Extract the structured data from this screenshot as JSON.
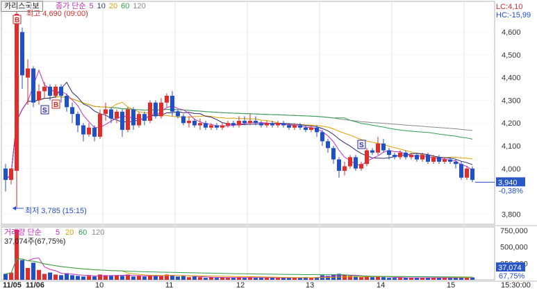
{
  "header": {
    "stock_name": "카리스국보",
    "price_legend": {
      "label": "종가 단순",
      "periods": [
        "5",
        "10",
        "20",
        "60",
        "120"
      ]
    },
    "lc": "LC:4,10",
    "hc": "HC:-15,99",
    "max_note": "최고 4,690 (09:00)",
    "min_note": "최저 3,785 (15:15)",
    "marker_b": "B",
    "marker_s": "S"
  },
  "volume_panel": {
    "legend_label": "거래량 단순",
    "periods": [
      "5",
      "20",
      "60",
      "120"
    ],
    "current": "37,074주(67,75%)",
    "axis_labels": [
      "750,000",
      "500,000",
      "250,000"
    ],
    "current_box": "37,074",
    "current_pct": "67,75%"
  },
  "last_price": {
    "value": "3,940",
    "pct": "-0,38%"
  },
  "colors": {
    "up": "#e62a2a",
    "down": "#1f4fd1",
    "ma5": "#c030c0",
    "ma10": "#2a2a66",
    "ma20": "#e0a000",
    "ma60": "#2ea050",
    "ma120": "#8a8a8a",
    "last_box": "#2a57c8"
  },
  "chart_data": {
    "type": "candlestick",
    "interval": "intraday",
    "price_axis": {
      "ticks": [
        "4,600",
        "4,500",
        "4,400",
        "4,300",
        "4,200",
        "4,100",
        "4,000",
        "3,800"
      ],
      "range": [
        3755,
        4735
      ]
    },
    "x_tick_labels": [
      "11/05",
      "11/06",
      "10",
      "11",
      "12",
      "13",
      "14",
      "15",
      "15:30:00"
    ],
    "annotations": {
      "high": 4690,
      "high_time": "09:00",
      "low": 3785,
      "low_time": "15:15"
    },
    "last_price": 3940,
    "candles": [
      [
        4000,
        3950,
        3900,
        4020
      ],
      [
        3950,
        4000,
        3930,
        4000
      ],
      [
        3990,
        4680,
        3980,
        4690
      ],
      [
        4600,
        4410,
        4350,
        4620
      ],
      [
        4400,
        4440,
        4280,
        4480
      ],
      [
        4440,
        4290,
        4270,
        4450
      ],
      [
        4300,
        4340,
        4280,
        4370
      ],
      [
        4340,
        4360,
        4310,
        4380
      ],
      [
        4360,
        4320,
        4300,
        4370
      ],
      [
        4320,
        4360,
        4310,
        4370
      ],
      [
        4360,
        4320,
        4290,
        4370
      ],
      [
        4320,
        4270,
        4250,
        4330
      ],
      [
        4270,
        4240,
        4200,
        4290
      ],
      [
        4240,
        4190,
        4160,
        4250
      ],
      [
        4190,
        4150,
        4120,
        4200
      ],
      [
        4150,
        4180,
        4140,
        4200
      ],
      [
        4180,
        4140,
        4120,
        4190
      ],
      [
        4140,
        4240,
        4130,
        4260
      ],
      [
        4240,
        4260,
        4210,
        4290
      ],
      [
        4260,
        4220,
        4200,
        4270
      ],
      [
        4220,
        4250,
        4200,
        4260
      ],
      [
        4250,
        4170,
        4140,
        4260
      ],
      [
        4170,
        4260,
        4160,
        4270
      ],
      [
        4260,
        4190,
        4170,
        4270
      ],
      [
        4190,
        4240,
        4180,
        4250
      ],
      [
        4240,
        4210,
        4190,
        4250
      ],
      [
        4210,
        4290,
        4200,
        4300
      ],
      [
        4290,
        4230,
        4220,
        4300
      ],
      [
        4230,
        4290,
        4220,
        4310
      ],
      [
        4290,
        4320,
        4270,
        4330
      ],
      [
        4320,
        4250,
        4230,
        4340
      ],
      [
        4250,
        4230,
        4220,
        4260
      ],
      [
        4230,
        4200,
        4190,
        4240
      ],
      [
        4200,
        4210,
        4180,
        4230
      ],
      [
        4210,
        4190,
        4180,
        4220
      ],
      [
        4190,
        4200,
        4170,
        4220
      ],
      [
        4200,
        4180,
        4170,
        4210
      ],
      [
        4180,
        4190,
        4170,
        4200
      ],
      [
        4190,
        4180,
        4170,
        4200
      ],
      [
        4180,
        4190,
        4170,
        4200
      ],
      [
        4190,
        4200,
        4180,
        4210
      ],
      [
        4200,
        4190,
        4180,
        4210
      ],
      [
        4190,
        4210,
        4180,
        4230
      ],
      [
        4210,
        4200,
        4190,
        4230
      ],
      [
        4200,
        4210,
        4190,
        4240
      ],
      [
        4210,
        4200,
        4190,
        4230
      ],
      [
        4200,
        4190,
        4180,
        4210
      ],
      [
        4190,
        4200,
        4180,
        4210
      ],
      [
        4200,
        4190,
        4180,
        4210
      ],
      [
        4190,
        4200,
        4180,
        4210
      ],
      [
        4200,
        4190,
        4180,
        4210
      ],
      [
        4190,
        4180,
        4170,
        4200
      ],
      [
        4180,
        4190,
        4170,
        4200
      ],
      [
        4190,
        4180,
        4170,
        4200
      ],
      [
        4180,
        4170,
        4160,
        4190
      ],
      [
        4170,
        4180,
        4160,
        4190
      ],
      [
        4180,
        4160,
        4140,
        4190
      ],
      [
        4160,
        4120,
        4100,
        4170
      ],
      [
        4120,
        4090,
        4070,
        4130
      ],
      [
        4090,
        4040,
        4020,
        4100
      ],
      [
        4040,
        3990,
        3960,
        4050
      ],
      [
        3990,
        4010,
        3970,
        4030
      ],
      [
        4010,
        4050,
        4000,
        4060
      ],
      [
        4050,
        4000,
        3990,
        4060
      ],
      [
        4000,
        4020,
        3990,
        4030
      ],
      [
        4020,
        4080,
        4010,
        4090
      ],
      [
        4080,
        4070,
        4060,
        4090
      ],
      [
        4070,
        4110,
        4060,
        4140
      ],
      [
        4110,
        4080,
        4070,
        4130
      ],
      [
        4080,
        4060,
        4040,
        4090
      ],
      [
        4060,
        4050,
        4040,
        4070
      ],
      [
        4050,
        4070,
        4040,
        4080
      ],
      [
        4070,
        4050,
        4040,
        4080
      ],
      [
        4050,
        4060,
        4040,
        4070
      ],
      [
        4060,
        4040,
        4030,
        4070
      ],
      [
        4040,
        4060,
        4030,
        4070
      ],
      [
        4060,
        4030,
        4020,
        4070
      ],
      [
        4030,
        4050,
        4020,
        4060
      ],
      [
        4050,
        4030,
        4020,
        4060
      ],
      [
        4030,
        4040,
        4020,
        4050
      ],
      [
        4040,
        4030,
        4020,
        4050
      ],
      [
        4030,
        4020,
        4000,
        4040
      ],
      [
        4020,
        3960,
        3950,
        4030
      ],
      [
        3960,
        4000,
        3950,
        4010
      ],
      [
        4000,
        3950,
        3940,
        4010
      ]
    ],
    "volume": [
      90,
      110,
      760,
      300,
      180,
      260,
      150,
      90,
      110,
      80,
      70,
      100,
      70,
      60,
      50,
      60,
      50,
      80,
      70,
      60,
      70,
      60,
      80,
      50,
      60,
      50,
      70,
      60,
      60,
      80,
      70,
      50,
      60,
      40,
      50,
      40,
      30,
      40,
      30,
      40,
      30,
      30,
      40,
      30,
      40,
      30,
      30,
      30,
      30,
      30,
      30,
      30,
      30,
      30,
      40,
      30,
      40,
      70,
      60,
      80,
      90,
      70,
      60,
      50,
      40,
      60,
      40,
      50,
      40,
      30,
      30,
      30,
      30,
      30,
      30,
      30,
      30,
      30,
      30,
      30,
      30,
      30,
      40,
      30,
      37
    ]
  }
}
